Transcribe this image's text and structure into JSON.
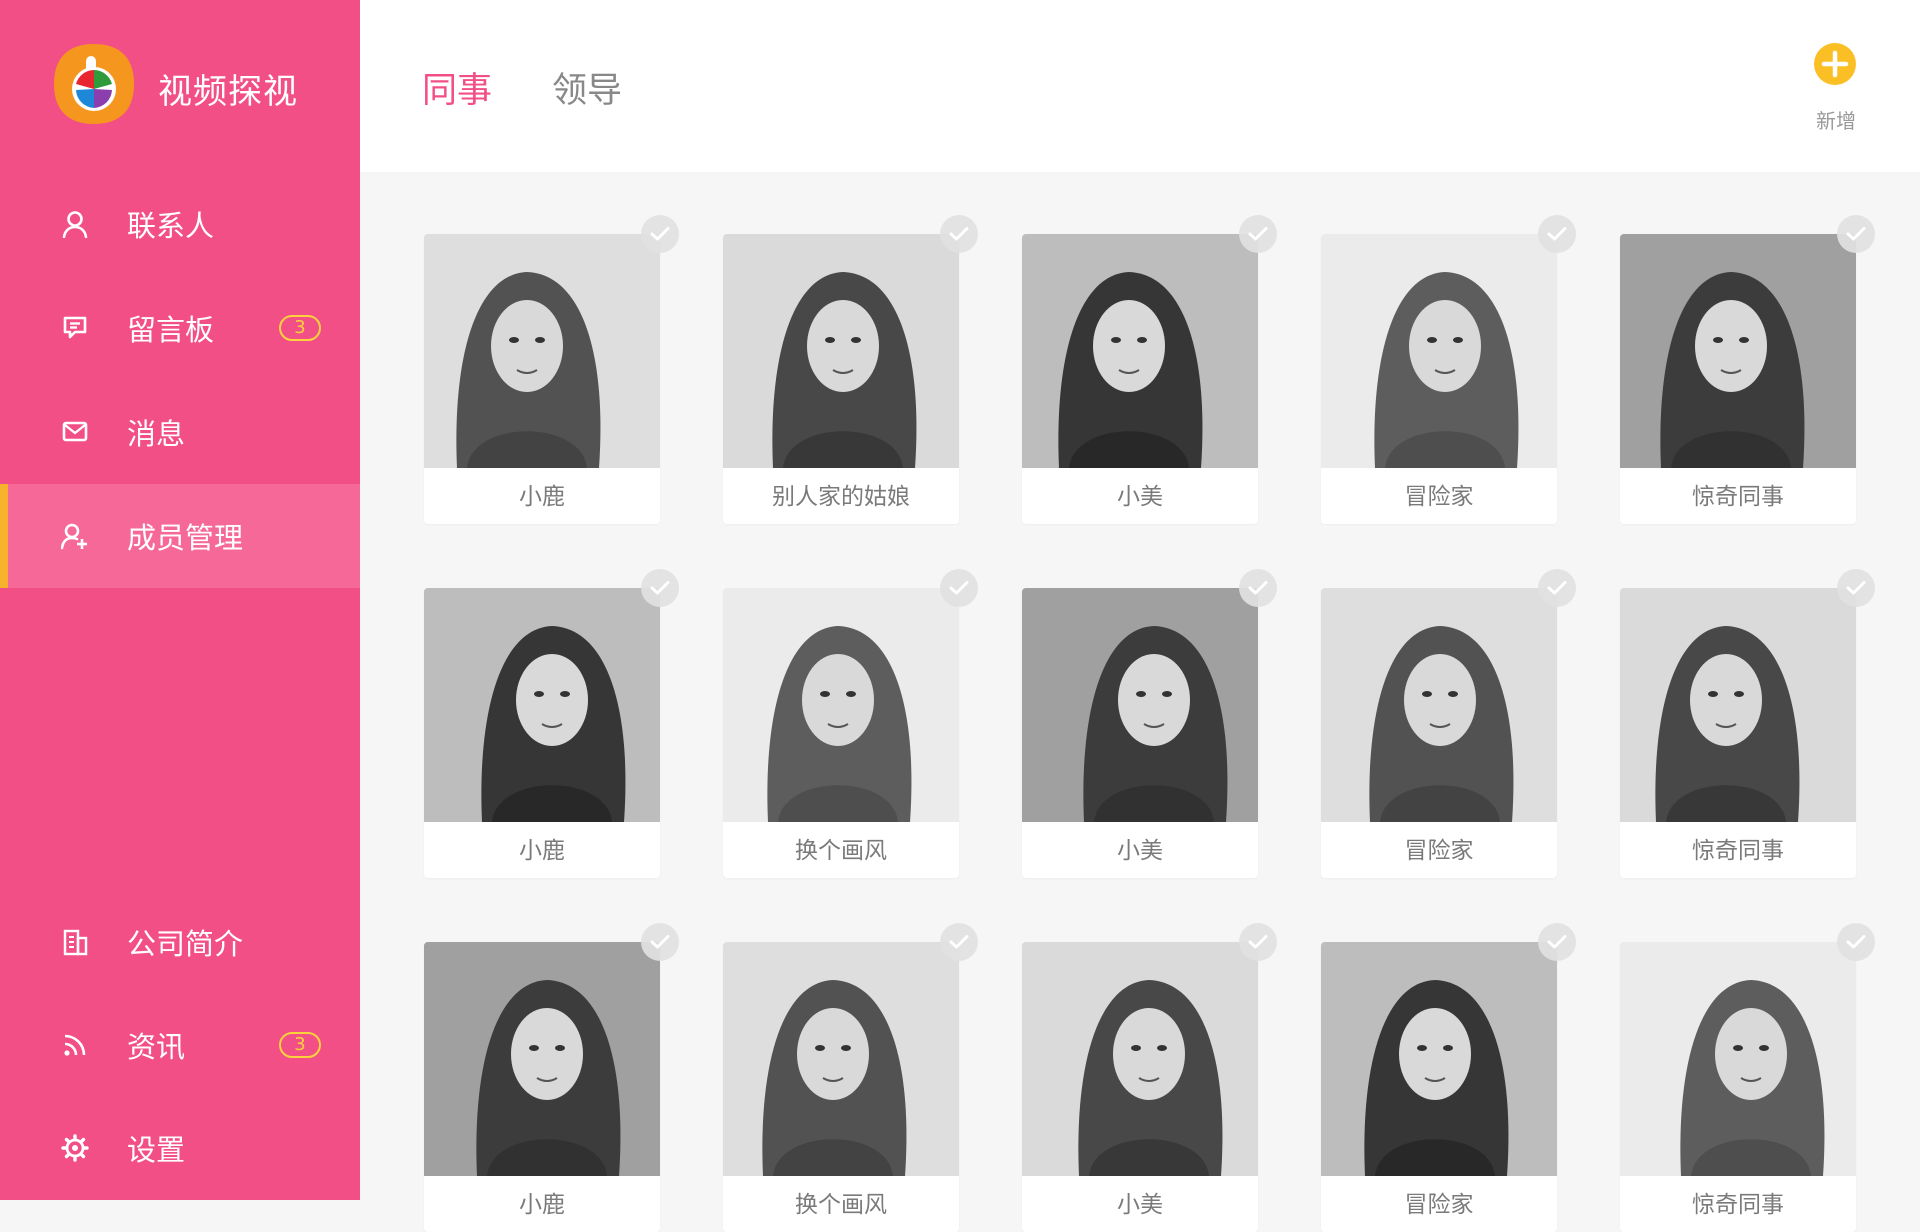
{
  "app": {
    "title": "视频探视"
  },
  "sidebar": {
    "items": [
      {
        "label": "联系人",
        "icon": "user-icon"
      },
      {
        "label": "留言板",
        "icon": "message-board-icon",
        "badge": "3"
      },
      {
        "label": "消息",
        "icon": "mail-icon"
      },
      {
        "label": "成员管理",
        "icon": "member-management-icon",
        "active": true
      },
      {
        "label": "公司简介",
        "icon": "building-icon"
      },
      {
        "label": "资讯",
        "icon": "rss-icon",
        "badge": "3"
      },
      {
        "label": "设置",
        "icon": "gear-icon"
      }
    ]
  },
  "header": {
    "tabs": [
      {
        "label": "同事",
        "active": true
      },
      {
        "label": "领导",
        "active": false
      }
    ],
    "add_label": "新增"
  },
  "members": [
    {
      "name": "小鹿"
    },
    {
      "name": "别人家的姑娘"
    },
    {
      "name": "小美"
    },
    {
      "name": "冒险家"
    },
    {
      "name": "惊奇同事"
    },
    {
      "name": "小鹿"
    },
    {
      "name": "换个画风"
    },
    {
      "name": "小美"
    },
    {
      "name": "冒险家"
    },
    {
      "name": "惊奇同事"
    },
    {
      "name": "小鹿"
    },
    {
      "name": "换个画风"
    },
    {
      "name": "小美"
    },
    {
      "name": "冒险家"
    },
    {
      "name": "惊奇同事"
    }
  ],
  "colors": {
    "sidebar_bg": "#f34f87",
    "active_item_bg": "#f66897",
    "active_indicator": "#f8b32d",
    "badge": "#fbd23c",
    "tab_active": "#f34f87",
    "add_button": "#fbbf26"
  }
}
